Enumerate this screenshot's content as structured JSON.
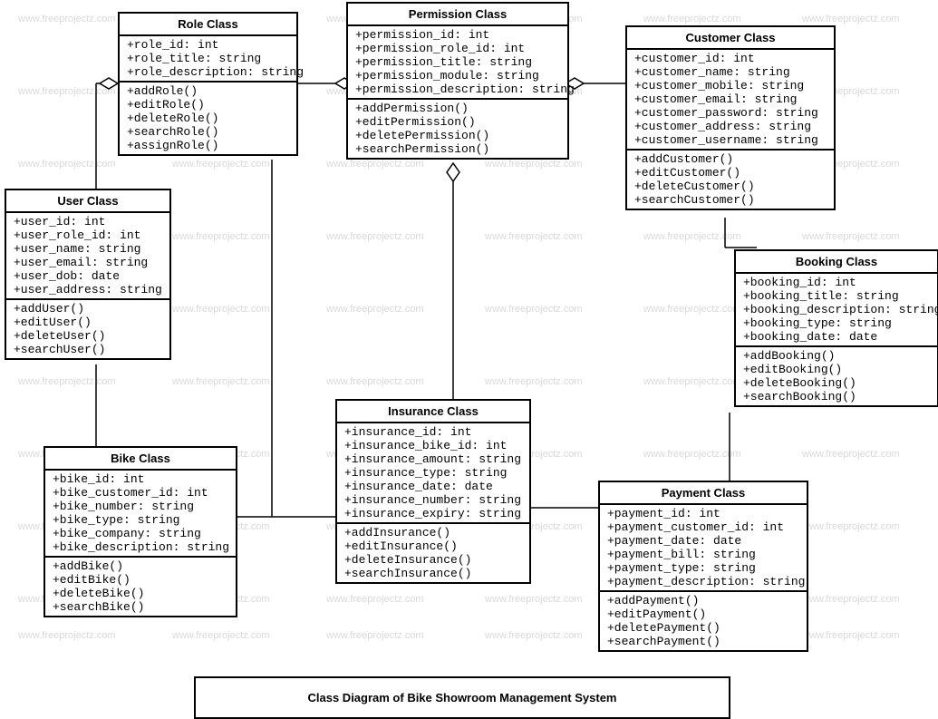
{
  "diagram_title": "Class Diagram of Bike Showroom Management System",
  "watermark_text": "www.freeprojectz.com",
  "classes": {
    "role": {
      "title": "Role Class",
      "attributes": [
        "+role_id: int",
        "+role_title: string",
        "+role_description: string"
      ],
      "methods": [
        "+addRole()",
        "+editRole()",
        "+deleteRole()",
        "+searchRole()",
        "+assignRole()"
      ]
    },
    "permission": {
      "title": "Permission Class",
      "attributes": [
        "+permission_id: int",
        "+permission_role_id: int",
        "+permission_title: string",
        "+permission_module: string",
        "+permission_description: string"
      ],
      "methods": [
        "+addPermission()",
        "+editPermission()",
        "+deletePermission()",
        "+searchPermission()"
      ]
    },
    "customer": {
      "title": "Customer Class",
      "attributes": [
        "+customer_id: int",
        "+customer_name: string",
        "+customer_mobile: string",
        "+customer_email: string",
        "+customer_password: string",
        "+customer_address: string",
        "+customer_username: string"
      ],
      "methods": [
        "+addCustomer()",
        "+editCustomer()",
        "+deleteCustomer()",
        "+searchCustomer()"
      ]
    },
    "user": {
      "title": "User Class",
      "attributes": [
        "+user_id: int",
        "+user_role_id: int",
        "+user_name: string",
        "+user_email: string",
        "+user_dob: date",
        "+user_address: string"
      ],
      "methods": [
        "+addUser()",
        "+editUser()",
        "+deleteUser()",
        "+searchUser()"
      ]
    },
    "booking": {
      "title": "Booking Class",
      "attributes": [
        "+booking_id: int",
        "+booking_title: string",
        "+booking_description: string",
        "+booking_type: string",
        "+booking_date: date"
      ],
      "methods": [
        "+addBooking()",
        "+editBooking()",
        "+deleteBooking()",
        "+searchBooking()"
      ]
    },
    "insurance": {
      "title": "Insurance Class",
      "attributes": [
        "+insurance_id: int",
        "+insurance_bike_id: int",
        "+insurance_amount: string",
        "+insurance_type: string",
        "+insurance_date: date",
        "+insurance_number: string",
        "+insurance_expiry: string"
      ],
      "methods": [
        "+addInsurance()",
        "+editInsurance()",
        "+deleteInsurance()",
        "+searchInsurance()"
      ]
    },
    "bike": {
      "title": "Bike Class",
      "attributes": [
        "+bike_id: int",
        "+bike_customer_id: int",
        "+bike_number: string",
        "+bike_type: string",
        "+bike_company: string",
        "+bike_description: string"
      ],
      "methods": [
        "+addBike()",
        "+editBike()",
        "+deleteBike()",
        "+searchBike()"
      ]
    },
    "payment": {
      "title": "Payment Class",
      "attributes": [
        "+payment_id: int",
        "+payment_customer_id: int",
        "+payment_date: date",
        "+payment_bill: string",
        "+payment_type: string",
        "+payment_description: string"
      ],
      "methods": [
        "+addPayment()",
        "+editPayment()",
        "+deletePayment()",
        "+searchPayment()"
      ]
    }
  }
}
